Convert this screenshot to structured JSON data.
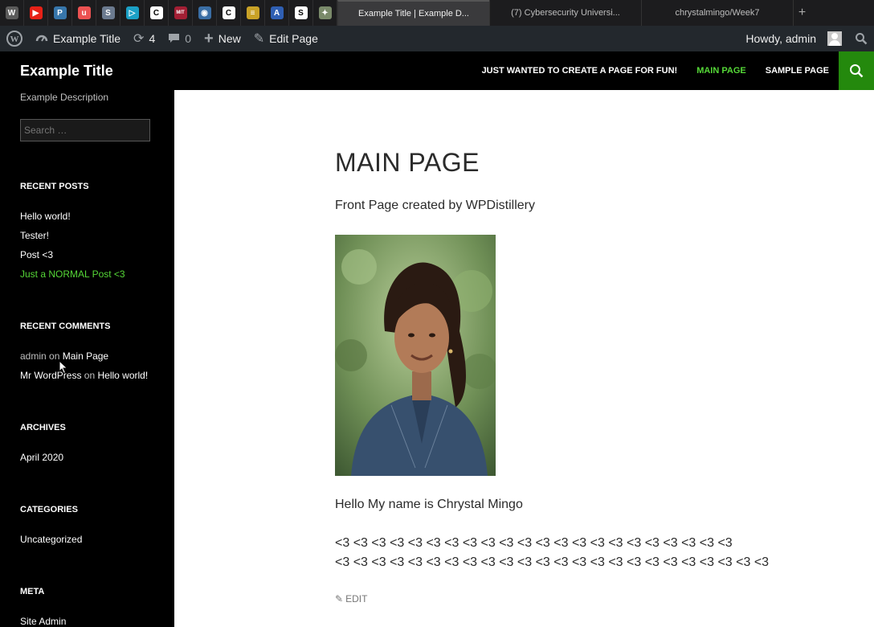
{
  "browser": {
    "pinned_tabs": [
      {
        "icon": "wordpress-icon",
        "color": "#5b5b5b",
        "glyph": "W"
      },
      {
        "icon": "youtube-icon",
        "color": "#e62117",
        "glyph": "▶"
      },
      {
        "icon": "python-icon",
        "color": "#3776ab",
        "glyph": "P"
      },
      {
        "icon": "udemy-icon",
        "color": "#ec5252",
        "glyph": "u"
      },
      {
        "icon": "s-app-icon",
        "color": "#6b7a8f",
        "glyph": "S"
      },
      {
        "icon": "play-app-icon",
        "color": "#1ba0c6",
        "glyph": "▷"
      },
      {
        "icon": "c-app-icon",
        "color": "#ffffff",
        "glyph": "C"
      },
      {
        "icon": "mit-ocw-icon",
        "color": "#a31f34",
        "glyph": "MIT"
      },
      {
        "icon": "globe-icon",
        "color": "#3a6ea5",
        "glyph": "◉"
      },
      {
        "icon": "c-app-icon-2",
        "color": "#ffffff",
        "glyph": "C"
      },
      {
        "icon": "notes-icon",
        "color": "#c9a227",
        "glyph": "≡"
      },
      {
        "icon": "a-app-icon",
        "color": "#2f5fb3",
        "glyph": "A"
      },
      {
        "icon": "s-black-icon",
        "color": "#ffffff",
        "glyph": "S"
      },
      {
        "icon": "bird-icon",
        "color": "#7a8a6a",
        "glyph": "✦"
      }
    ],
    "tabs": [
      {
        "label": "Example Title | Example D...",
        "active": true
      },
      {
        "label": "(7) Cybersecurity Universi...",
        "active": false
      },
      {
        "label": "chrystalmingo/Week7",
        "active": false
      }
    ]
  },
  "adminbar": {
    "site_name": "Example Title",
    "updates_count": "4",
    "comments_count": "0",
    "new_label": "New",
    "edit_label": "Edit Page",
    "howdy": "Howdy, admin"
  },
  "header": {
    "site_title": "Example Title",
    "nav": [
      {
        "label": "JUST WANTED TO CREATE A PAGE FOR FUN!",
        "current": false
      },
      {
        "label": "MAIN PAGE",
        "current": true
      },
      {
        "label": "SAMPLE PAGE",
        "current": false
      }
    ]
  },
  "sidebar": {
    "description": "Example Description",
    "search_placeholder": "Search …",
    "recent_posts_title": "RECENT POSTS",
    "recent_posts": [
      "Hello world!",
      "Tester!",
      "Post <3",
      "Just a NORMAL Post <3"
    ],
    "recent_comments_title": "RECENT COMMENTS",
    "recent_comments": [
      {
        "author": "admin",
        "on": "on",
        "post": "Main Page"
      },
      {
        "author": "Mr WordPress",
        "on": "on",
        "post": "Hello world!"
      }
    ],
    "archives_title": "ARCHIVES",
    "archives": [
      "April 2020"
    ],
    "categories_title": "CATEGORIES",
    "categories": [
      "Uncategorized"
    ],
    "meta_title": "META",
    "meta": [
      "Site Admin"
    ]
  },
  "main": {
    "title": "MAIN PAGE",
    "intro": "Front Page created by WPDistillery",
    "hello": "Hello My name is Chrystal Mingo",
    "hearts_line1": "<3 <3 <3 <3 <3 <3 <3 <3 <3 <3 <3 <3 <3 <3 <3 <3 <3 <3 <3 <3 <3 <3",
    "hearts_line2": "<3 <3 <3 <3 <3 <3 <3 <3 <3 <3 <3 <3 <3 <3 <3 <3 <3 <3 <3 <3 <3 <3 <3 <3",
    "edit_label": "EDIT"
  },
  "colors": {
    "accent_green": "#55d737",
    "search_green": "#24890d",
    "adminbar": "#23282d"
  }
}
